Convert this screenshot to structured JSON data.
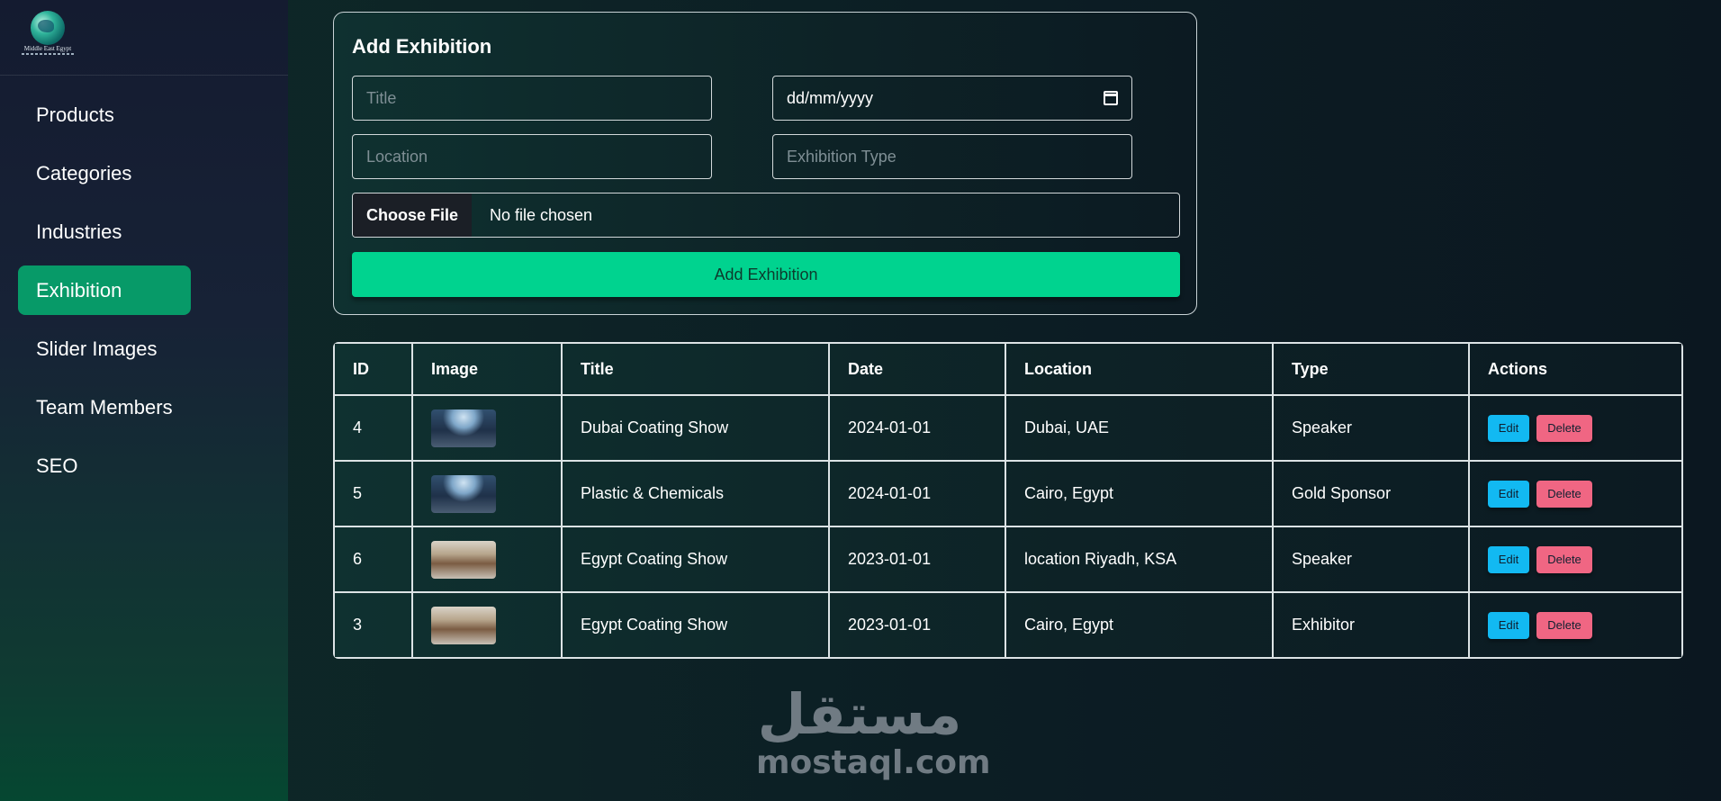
{
  "logo": {
    "text": "Middle East Egypt"
  },
  "sidebar": {
    "items": [
      {
        "label": "Products"
      },
      {
        "label": "Categories"
      },
      {
        "label": "Industries"
      },
      {
        "label": "Exhibition",
        "active": true
      },
      {
        "label": "Slider Images"
      },
      {
        "label": "Team Members"
      },
      {
        "label": "SEO"
      }
    ]
  },
  "form": {
    "title": "Add Exhibition",
    "title_placeholder": "Title",
    "date_value": "dd/mm/yyyy",
    "location_placeholder": "Location",
    "type_placeholder": "Exhibition Type",
    "file_button": "Choose File",
    "file_status": "No file chosen",
    "submit_label": "Add Exhibition"
  },
  "table": {
    "headers": [
      "ID",
      "Image",
      "Title",
      "Date",
      "Location",
      "Type",
      "Actions"
    ],
    "rows": [
      {
        "id": "4",
        "image": "blue",
        "title": "Dubai Coating Show",
        "date": "2024-01-01",
        "location": "Dubai, UAE",
        "type": "Speaker"
      },
      {
        "id": "5",
        "image": "blue",
        "title": "Plastic & Chemicals",
        "date": "2024-01-01",
        "location": "Cairo, Egypt",
        "type": "Gold Sponsor"
      },
      {
        "id": "6",
        "image": "booth",
        "title": "Egypt Coating Show",
        "date": "2023-01-01",
        "location": "location Riyadh, KSA",
        "type": "Speaker"
      },
      {
        "id": "3",
        "image": "booth",
        "title": "Egypt Coating Show",
        "date": "2023-01-01",
        "location": "Cairo, Egypt",
        "type": "Exhibitor"
      }
    ],
    "edit_label": "Edit",
    "delete_label": "Delete"
  },
  "watermark": {
    "arabic": "مستقل",
    "latin": "mostaql.com"
  },
  "colors": {
    "accent_active": "#079a68",
    "submit": "#00d38f",
    "edit": "#12b9f2",
    "delete": "#f06683"
  }
}
